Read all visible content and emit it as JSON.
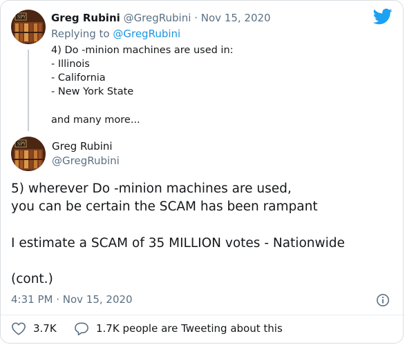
{
  "reply": {
    "author_name": "Greg Rubini",
    "handle": "@GregRubini",
    "dot": "·",
    "date": "Nov 15, 2020",
    "replying_prefix": "Replying to",
    "replying_handle": "@GregRubini",
    "lines": [
      "4) Do -minion machines are used in:",
      "- Illinois",
      "- California",
      "- New York State",
      "",
      "and many more..."
    ]
  },
  "main": {
    "author_name": "Greg Rubini",
    "handle": "@GregRubini",
    "lines": [
      "5) wherever Do -minion machines are used,",
      "you can be certain the SCAM has been rampant",
      "",
      "I estimate a SCAM of 35 MILLION votes - Nationwide",
      "",
      "(cont.)"
    ],
    "timestamp": "4:31 PM · Nov 15, 2020"
  },
  "actions": {
    "likes": "3.7K",
    "conversation": "1.7K people are Tweeting about this"
  },
  "colors": {
    "twitter_blue": "#1da1f2",
    "link_blue": "#1b95e0",
    "muted": "#5b7083"
  },
  "icons": {
    "logo": "twitter-bird-icon",
    "info": "info-icon",
    "like": "heart-icon",
    "conversation": "speech-bubble-icon"
  }
}
